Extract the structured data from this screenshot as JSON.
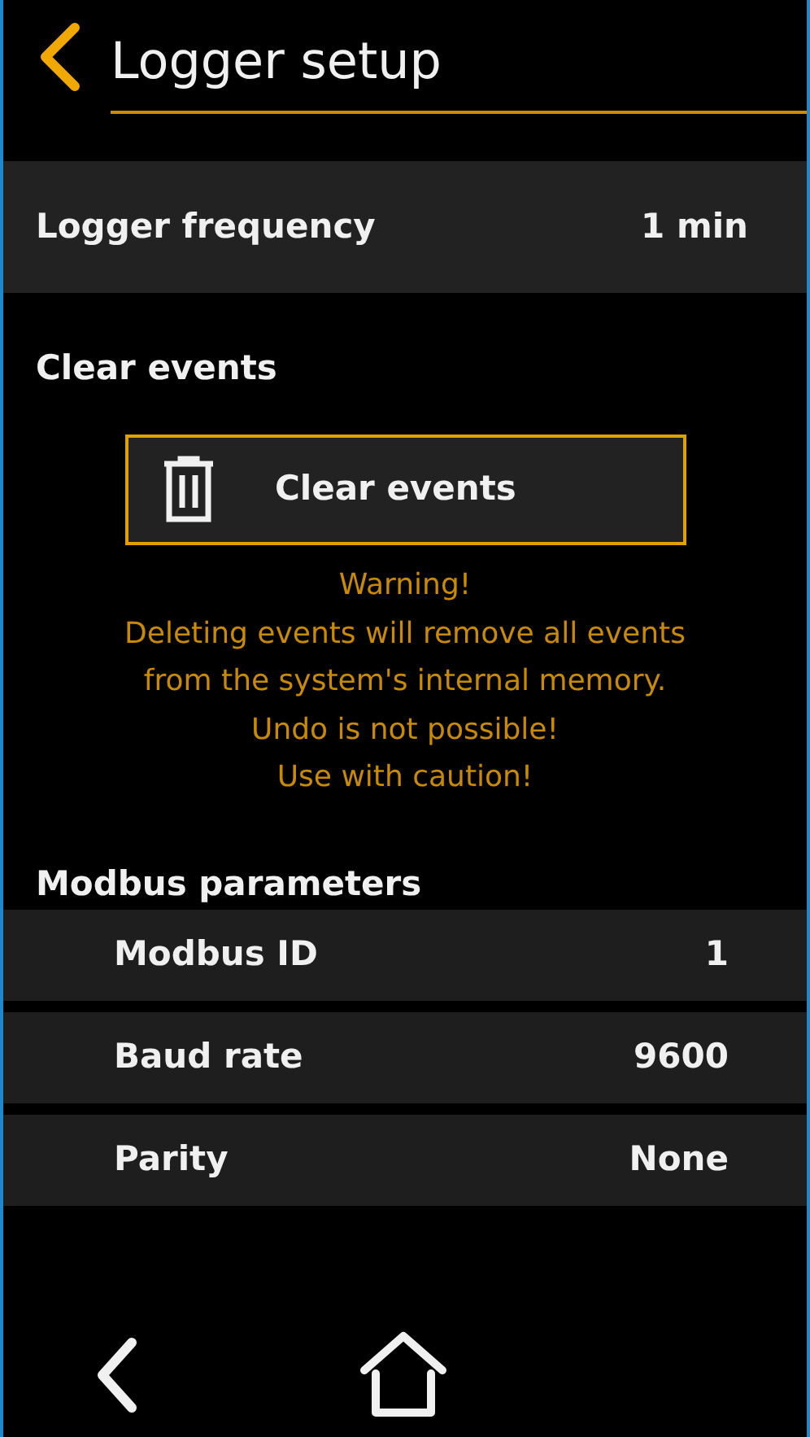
{
  "header": {
    "title": "Logger setup"
  },
  "logger_frequency": {
    "label": "Logger frequency",
    "value": "1 min"
  },
  "clear_events": {
    "heading": "Clear events",
    "button": "Clear events",
    "warning": [
      "Warning!",
      "Deleting events will remove all events",
      "from the system's internal memory.",
      "Undo is not possible!",
      "Use with caution!"
    ]
  },
  "modbus": {
    "heading": "Modbus parameters",
    "rows": [
      {
        "label": "Modbus ID",
        "value": "1"
      },
      {
        "label": "Baud rate",
        "value": "9600"
      },
      {
        "label": "Parity",
        "value": "None"
      }
    ]
  }
}
